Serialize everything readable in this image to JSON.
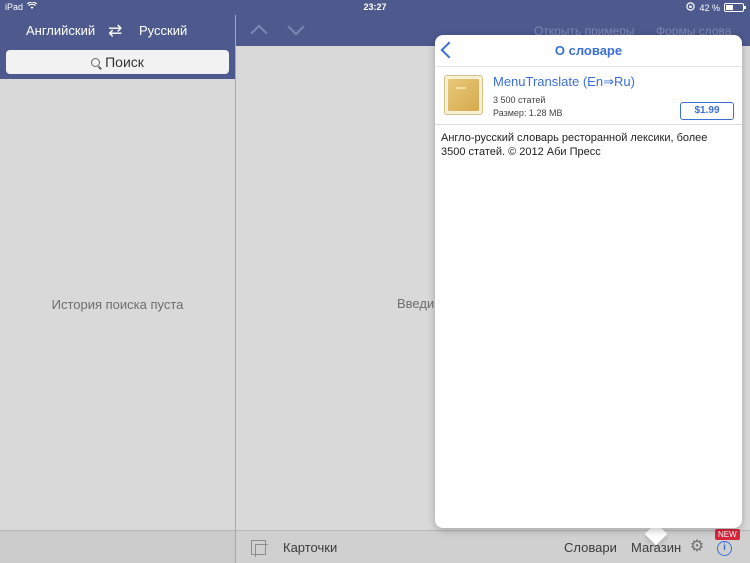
{
  "status_bar": {
    "device": "iPad",
    "time": "23:27",
    "battery_text": "42 %",
    "battery_level": 0.42
  },
  "left_panel": {
    "source_language": "Английский",
    "target_language": "Русский",
    "swap_glyph": "⇄",
    "search_placeholder": "Поиск",
    "empty_history": "История поиска пуста"
  },
  "main_panel": {
    "examples_link": "Открыть примеры",
    "forms_link": "Формы слова",
    "hint": "Введи"
  },
  "footer": {
    "cards": "Карточки",
    "dictionaries": "Словари",
    "store": "Магазин",
    "new_badge": "NEW",
    "info_glyph": "i"
  },
  "popover": {
    "title": "О словаре",
    "dictionary": {
      "name": "MenuTranslate (En⇒Ru)",
      "entries": "3 500 статей",
      "size": "Размер: 1.28 MB",
      "price": "$1.99",
      "description": "Англо-русский словарь ресторанной лексики, более 3500 статей. © 2012 Аби Пресс"
    }
  },
  "colors": {
    "header": "#4e5a8e",
    "accent": "#3a6fd6",
    "badge": "#d7263d"
  },
  "icons": [
    "wifi-icon",
    "lock-rotation-icon",
    "battery-icon",
    "swap-icon",
    "search-icon",
    "chevron-up-icon",
    "chevron-down-icon",
    "cards-icon",
    "gear-icon",
    "info-icon",
    "back-chevron-icon",
    "book-icon"
  ]
}
